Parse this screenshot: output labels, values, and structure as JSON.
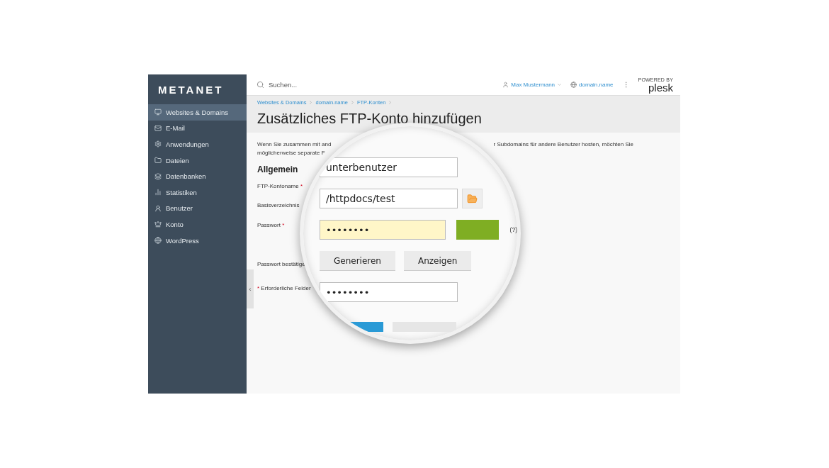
{
  "logo": "METANET",
  "sidebar": {
    "items": [
      {
        "label": "Websites & Domains",
        "selected": true
      },
      {
        "label": "E-Mail",
        "selected": false
      },
      {
        "label": "Anwendungen",
        "selected": false
      },
      {
        "label": "Dateien",
        "selected": false
      },
      {
        "label": "Datenbanken",
        "selected": false
      },
      {
        "label": "Statistiken",
        "selected": false
      },
      {
        "label": "Benutzer",
        "selected": false
      },
      {
        "label": "Konto",
        "selected": false
      },
      {
        "label": "WordPress",
        "selected": false
      }
    ],
    "collapse": "‹"
  },
  "topbar": {
    "search": {
      "placeholder": "Suchen..."
    },
    "user": "Max Mustermann",
    "domain": "domain.name",
    "powered_by": "POWERED BY",
    "brand": "plesk"
  },
  "breadcrumbs": [
    "Websites & Domains",
    "domain.name",
    "FTP-Konten"
  ],
  "title": "Zusätzliches FTP-Konto hinzufügen",
  "intro": {
    "left_lines": [
      "Wenn Sie zusammen mit and",
      "möglicherweise separate F"
    ],
    "right_line": "r Subdomains für andere Benutzer hosten, möchten Sie"
  },
  "section": "Allgemein",
  "labels": [
    {
      "text": "FTP-Kontoname",
      "mark": "*"
    },
    {
      "text": "Basisverzeichnis"
    },
    {
      "text": "Passwort",
      "mark": "*"
    },
    {
      "text": "Passwort bestätige"
    }
  ],
  "required_note": {
    "mark": "*",
    "text": "Erforderliche Felder"
  },
  "magnifier": {
    "username": "unterbenutzer",
    "directory": "/httpdocs/test",
    "password": "••••••••",
    "help": "(?)",
    "buttons": [
      "Generieren",
      "Anzeigen"
    ],
    "confirm": "••••••••"
  }
}
